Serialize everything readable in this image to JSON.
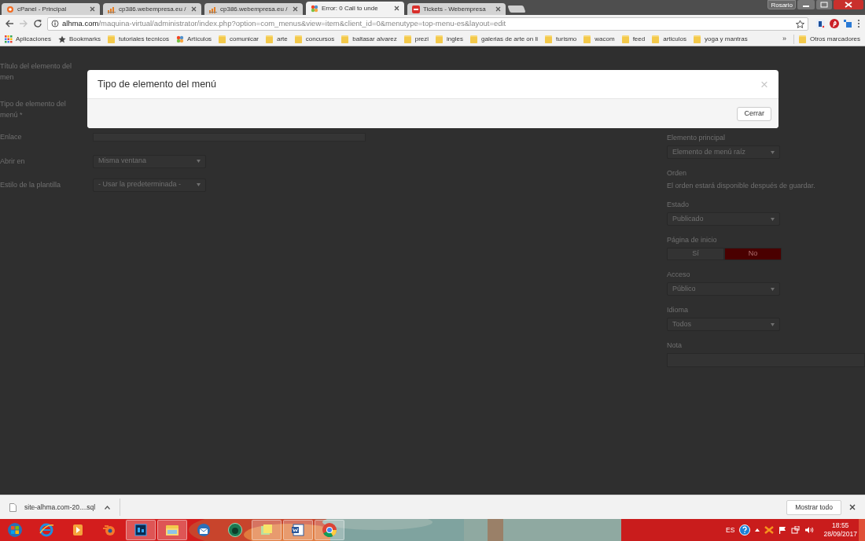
{
  "browser": {
    "tabs": [
      {
        "title": "cPanel - Principal",
        "kind": "cpanel",
        "selected": false
      },
      {
        "title": "cp386.webempresa.eu /",
        "kind": "bars",
        "selected": false
      },
      {
        "title": "cp386.webempresa.eu /",
        "kind": "bars",
        "selected": false
      },
      {
        "title": "Error: 0 Call to unde",
        "kind": "joomla",
        "selected": true
      },
      {
        "title": "Tickets - Webempresa",
        "kind": "tickets",
        "selected": false
      }
    ],
    "profile": "Rosario",
    "address": {
      "host": "alhma.com",
      "path": "/maquina-virtual/administrator/index.php?option=com_menus&view=item&client_id=0&menutype=top-menu-es&layout=edit"
    },
    "bookmarks": [
      {
        "label": "Aplicaciones",
        "kind": "apps"
      },
      {
        "label": "Bookmarks",
        "kind": "star"
      },
      {
        "label": "tutoriales tecnicos",
        "kind": "folder"
      },
      {
        "label": "Artículos",
        "kind": "joomla"
      },
      {
        "label": "comunicar",
        "kind": "folder"
      },
      {
        "label": "arte",
        "kind": "folder"
      },
      {
        "label": "concursos",
        "kind": "folder"
      },
      {
        "label": "baltasar alvarez",
        "kind": "folder"
      },
      {
        "label": "prezi",
        "kind": "folder"
      },
      {
        "label": "ingles",
        "kind": "folder"
      },
      {
        "label": "galerias de arte on li",
        "kind": "folder"
      },
      {
        "label": "turismo",
        "kind": "folder"
      },
      {
        "label": "wacom",
        "kind": "folder"
      },
      {
        "label": "feed",
        "kind": "folder"
      },
      {
        "label": "articulos",
        "kind": "folder"
      },
      {
        "label": "yoga y mantras",
        "kind": "folder"
      }
    ],
    "bookmarks_more": "»",
    "other_bookmarks": "Otros marcadores"
  },
  "page": {
    "left_fields": [
      {
        "label": "Título del elemento del men",
        "kind": "label"
      },
      {
        "label": "Tipo de elemento del menú *",
        "kind": "label"
      },
      {
        "label": "Enlace",
        "kind": "text"
      },
      {
        "label": "Abrir en",
        "kind": "select",
        "value": "Misma ventana"
      },
      {
        "label": "Estilo de la plantilla",
        "kind": "select",
        "value": "- Usar la predeterminada -"
      }
    ],
    "right_fields": [
      {
        "label": "Elemento principal",
        "kind": "select",
        "value": "Elemento de menú raíz"
      },
      {
        "label": "Orden",
        "kind": "note",
        "text": "El orden estará disponible después de guardar."
      },
      {
        "label": "Estado",
        "kind": "select",
        "value": "Publicado"
      },
      {
        "label": "Página de inicio",
        "kind": "toggle",
        "options": [
          {
            "label": "Sí",
            "selected": false
          },
          {
            "label": "No",
            "selected": true
          }
        ]
      },
      {
        "label": "Acceso",
        "kind": "select",
        "value": "Público"
      },
      {
        "label": "Idioma",
        "kind": "select",
        "value": "Todos"
      },
      {
        "label": "Nota",
        "kind": "text"
      }
    ]
  },
  "modal": {
    "title": "Tipo de elemento del menú",
    "close": "×",
    "button": "Cerrar"
  },
  "downloads": {
    "file": "site-alhma.com-20....sql",
    "show_all": "Mostrar todo"
  },
  "taskbar": {
    "apps": [
      {
        "kind": "start",
        "open": false
      },
      {
        "kind": "ie",
        "open": false
      },
      {
        "kind": "media",
        "open": false
      },
      {
        "kind": "blender",
        "open": false
      },
      {
        "kind": "photoshop",
        "open": true
      },
      {
        "kind": "explorer",
        "open": true
      },
      {
        "kind": "mail",
        "open": false
      },
      {
        "kind": "globe",
        "open": false
      },
      {
        "kind": "notes",
        "open": true
      },
      {
        "kind": "word",
        "open": true
      },
      {
        "kind": "chrome",
        "open": true
      }
    ],
    "language": "ES",
    "time": "18:55",
    "date": "28/09/2017"
  }
}
